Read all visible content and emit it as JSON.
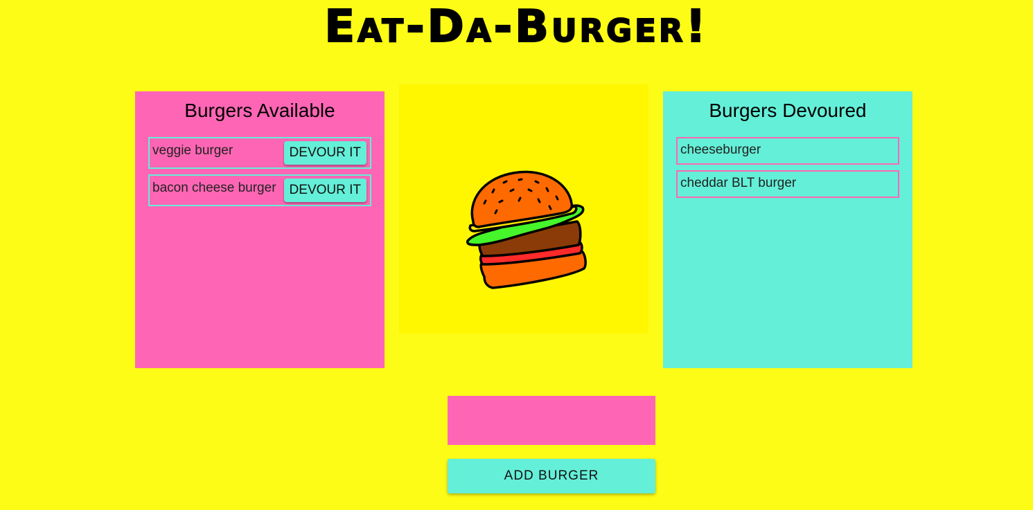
{
  "app": {
    "title": "Eat-Da-Burger!"
  },
  "available": {
    "heading": "Burgers Available",
    "items": [
      {
        "name": "veggie burger",
        "button_label": "DEVOUR IT"
      },
      {
        "name": "bacon cheese burger",
        "button_label": "DEVOUR IT"
      }
    ]
  },
  "devoured": {
    "heading": "Burgers Devoured",
    "items": [
      {
        "name": "cheeseburger"
      },
      {
        "name": "cheddar BLT burger"
      }
    ]
  },
  "form": {
    "input_value": "",
    "input_placeholder": "",
    "submit_label": "ADD BURGER"
  },
  "illustration": {
    "icon": "burger-icon"
  },
  "colors": {
    "background": "#fcfc17",
    "pink": "#fe66b5",
    "teal": "#64efd8",
    "image_bg": "#fff700"
  }
}
